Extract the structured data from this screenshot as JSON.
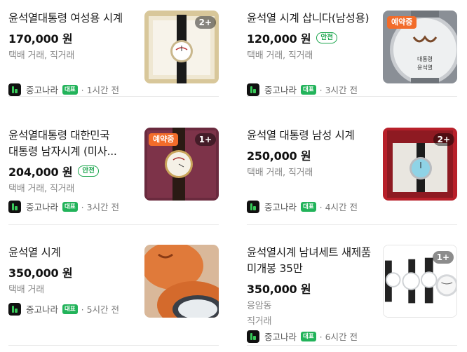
{
  "listings": [
    {
      "title": "윤석열대통령 여성용 시계",
      "price": "170,000 원",
      "safe_badge": "",
      "delivery": "택배 거래, 직거래",
      "location": "",
      "market": "중고나라",
      "rep_badge": "대표",
      "time": "· 1시간 전",
      "image_count": "2+",
      "reserved": ""
    },
    {
      "title": "윤석열 시계 삽니다(남성용)",
      "price": "120,000 원",
      "safe_badge": "안전",
      "delivery": "택배 거래, 직거래",
      "location": "",
      "market": "중고나라",
      "rep_badge": "대표",
      "time": "· 3시간 전",
      "image_count": "",
      "reserved": "예약중"
    },
    {
      "title": "윤석열대통령 대한민국 대통령 남자시계 (미사...",
      "price": "204,000 원",
      "safe_badge": "안전",
      "delivery": "택배 거래, 직거래",
      "location": "",
      "market": "중고나라",
      "rep_badge": "대표",
      "time": "· 3시간 전",
      "image_count": "1+",
      "reserved": "예약중"
    },
    {
      "title": "윤석열 대통령 남성 시계",
      "price": "250,000 원",
      "safe_badge": "",
      "delivery": "택배 거래, 직거래",
      "location": "",
      "market": "중고나라",
      "rep_badge": "대표",
      "time": "· 4시간 전",
      "image_count": "2+",
      "reserved": ""
    },
    {
      "title": "윤석열 시계",
      "price": "350,000 원",
      "safe_badge": "",
      "delivery": "택배 거래",
      "location": "",
      "market": "중고나라",
      "rep_badge": "대표",
      "time": "· 5시간 전",
      "image_count": "",
      "reserved": ""
    },
    {
      "title": "윤석열시계 남녀세트 새제품 미개봉 35만",
      "price": "350,000 원",
      "safe_badge": "",
      "delivery": "응암동",
      "location": "직거래",
      "market": "중고나라",
      "rep_badge": "대표",
      "time": "· 6시간 전",
      "image_count": "1+",
      "reserved": ""
    }
  ],
  "colors": {
    "safe_green": "#1aa54c",
    "reserved_orange": "#f26c2a",
    "rep_green": "#22b35a"
  }
}
